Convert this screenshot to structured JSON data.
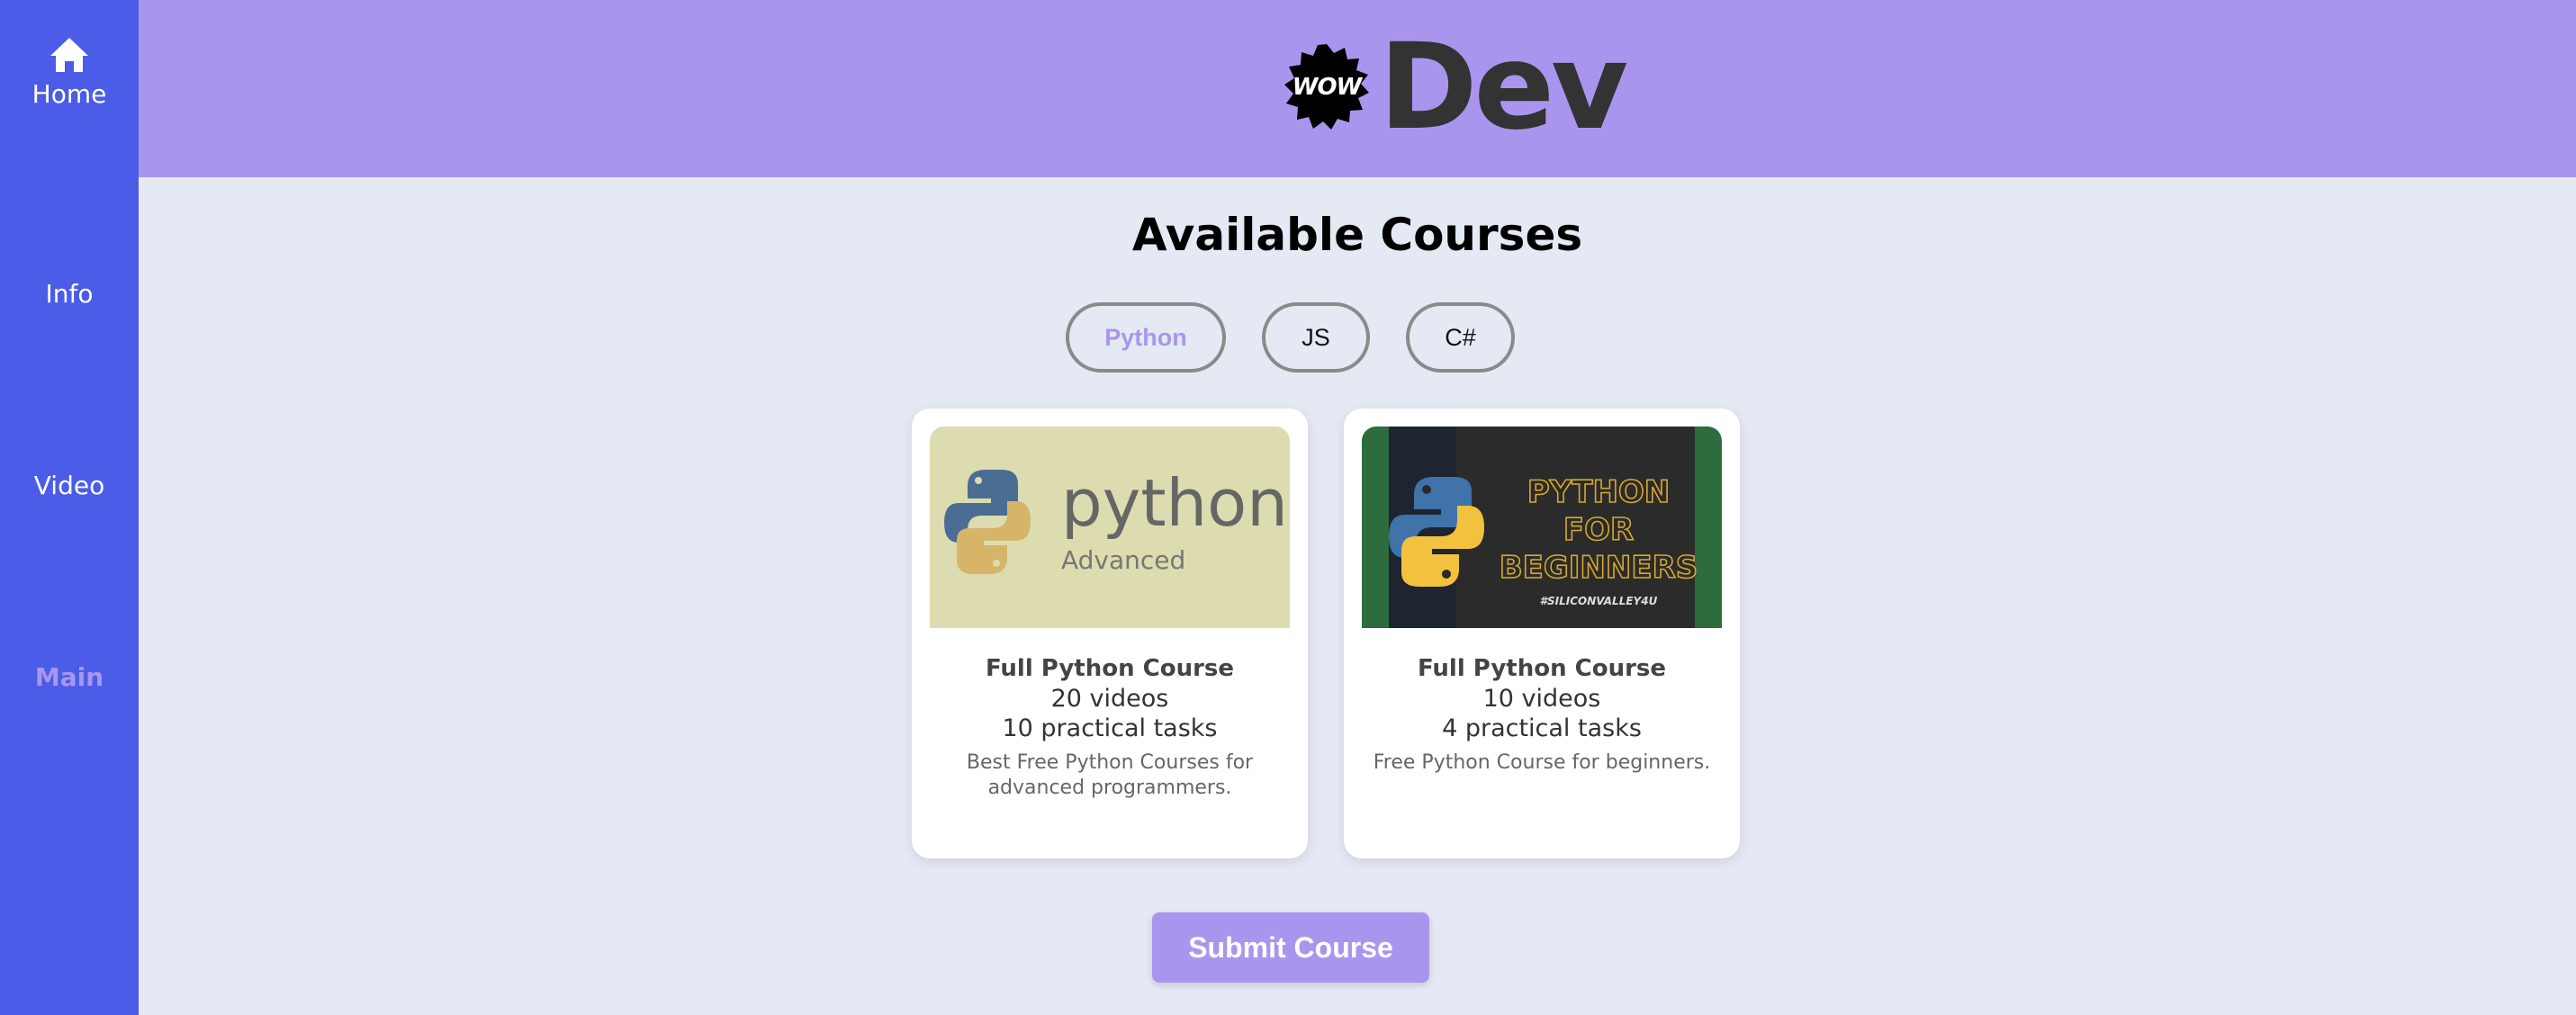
{
  "sidebar": {
    "items": [
      {
        "label": "Home",
        "icon": "home-icon"
      },
      {
        "label": "Info"
      },
      {
        "label": "Video"
      },
      {
        "label": "Main",
        "active": true
      }
    ]
  },
  "header": {
    "logo_badge": "WOW",
    "logo_text": "Dev"
  },
  "main": {
    "title": "Available Courses",
    "filters": [
      {
        "label": "Python",
        "active": true
      },
      {
        "label": "JS"
      },
      {
        "label": "C#"
      }
    ],
    "courses": [
      {
        "thumb": {
          "word": "python",
          "sub": "Advanced"
        },
        "title": "Full Python Course",
        "videos": "20 videos",
        "tasks": "10 practical tasks",
        "description": "Best Free Python Courses for advanced programmers."
      },
      {
        "thumb": {
          "lines": [
            "PYTHON",
            "FOR",
            "BEGINNERS"
          ],
          "tag": "#SILICONVALLEY4U"
        },
        "title": "Full Python Course",
        "videos": "10 videos",
        "tasks": "4 practical tasks",
        "description": "Free Python Course for beginners."
      }
    ],
    "submit_label": "Submit Course"
  },
  "colors": {
    "sidebar": "#4a5ce8",
    "header": "#aa95ee",
    "accent": "#a996ee",
    "background": "#e5e9f4"
  }
}
